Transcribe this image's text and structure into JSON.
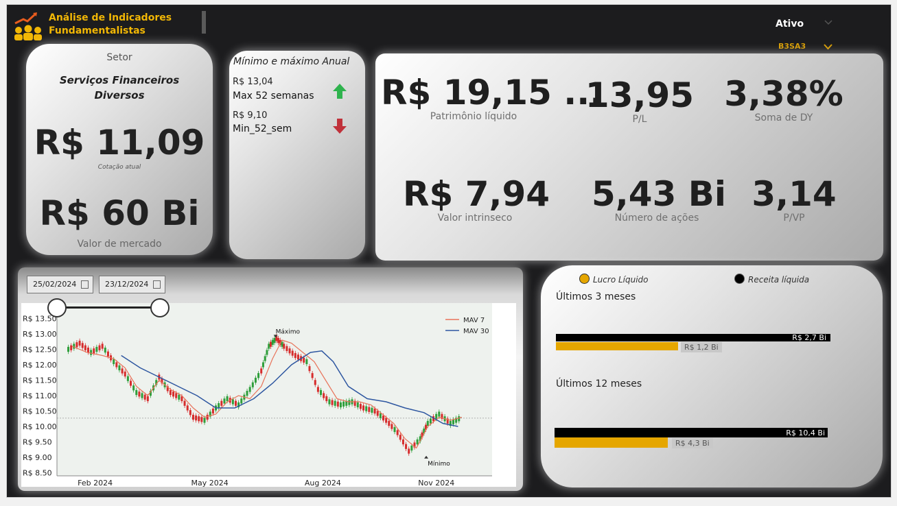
{
  "header": {
    "title_line1": "Análise de Indicadores",
    "title_line2": "Fundamentalistas",
    "logo_icon": "investors-growth-icon",
    "ativo_label": "Ativo",
    "ativo_selected": "B3SA3"
  },
  "setor_card": {
    "setor_label": "Setor",
    "setor_line1": "Serviços Financeiros",
    "setor_line2": "Diversos",
    "cotacao_value": "R$ 11,09",
    "cotacao_label": "Cotação atual",
    "mercado_value": "R$ 60 Bi",
    "mercado_label": "Valor de mercado"
  },
  "minmax_card": {
    "title": "Mínimo e máximo Anual",
    "max_value": "R$ 13,04",
    "max_label": "Max 52 semanas",
    "min_value": "R$ 9,10",
    "min_label": "Min_52_sem",
    "up_color": "#2fb34e",
    "down_color": "#c0313a"
  },
  "indicators": {
    "patrimonio_value": "R$ 19,15 ...",
    "patrimonio_label": "Patrimônio líquido",
    "pl_value": "13,95",
    "pl_label": "P/L",
    "dy_value": "3,38%",
    "dy_label": "Soma de DY",
    "intrinseco_value": "R$ 7,94",
    "intrinseco_label": "Valor intrinseco",
    "acoes_value": "5,43 Bi",
    "acoes_label": "Número de ações",
    "pvp_value": "3,14",
    "pvp_label": "P/VP"
  },
  "date_filter": {
    "start": "25/02/2024",
    "end": "23/12/2024"
  },
  "chart_data": {
    "type": "line",
    "x_ticks": [
      "Feb 2024",
      "May 2024",
      "Aug 2024",
      "Nov 2024"
    ],
    "y_ticks": [
      "R$ 13.50",
      "R$ 13.00",
      "R$ 12.50",
      "R$ 12.00",
      "R$ 11.50",
      "R$ 11.00",
      "R$ 10.50",
      "R$ 10.00",
      "R$ 9.50",
      "R$ 9.00",
      "R$ 8.50"
    ],
    "ylim": [
      8.4,
      13.6
    ],
    "xlim": [
      0,
      11.5
    ],
    "reference_line": 10.27,
    "annotations": [
      {
        "text": "Máximo",
        "x": 5.78,
        "y": 12.88
      },
      {
        "text": "Mínimo",
        "x": 9.76,
        "y": 9.05
      }
    ],
    "legend_position": "top-right",
    "series": [
      {
        "name": "MAV 7",
        "color": "#e8735a",
        "x": [
          0.4,
          0.8,
          1.2,
          1.5,
          1.8,
          2.1,
          2.4,
          2.7,
          3.0,
          3.3,
          3.6,
          3.9,
          4.2,
          4.5,
          4.8,
          5.1,
          5.4,
          5.7,
          5.95,
          6.2,
          6.5,
          6.8,
          7.1,
          7.4,
          7.7,
          8.0,
          8.3,
          8.6,
          8.9,
          9.2,
          9.5,
          9.8,
          10.1,
          10.4,
          10.7
        ],
        "y": [
          12.6,
          12.4,
          12.3,
          12.2,
          11.9,
          11.3,
          11.0,
          11.5,
          11.2,
          11.0,
          10.6,
          10.3,
          10.4,
          10.8,
          11.0,
          10.9,
          11.3,
          12.2,
          12.8,
          12.7,
          12.4,
          12.1,
          11.5,
          10.9,
          10.8,
          10.8,
          10.7,
          10.4,
          10.1,
          9.6,
          9.3,
          10.0,
          10.3,
          10.2,
          10.3
        ]
      },
      {
        "name": "MAV 30",
        "color": "#2d56a0",
        "x": [
          1.7,
          2.2,
          2.7,
          3.2,
          3.7,
          4.2,
          4.7,
          5.2,
          5.7,
          6.2,
          6.7,
          7.0,
          7.3,
          7.7,
          8.2,
          8.7,
          9.2,
          9.7,
          10.2,
          10.6
        ],
        "y": [
          12.3,
          11.9,
          11.6,
          11.3,
          11.0,
          10.6,
          10.6,
          10.9,
          11.4,
          12.0,
          12.4,
          12.45,
          12.1,
          11.3,
          10.9,
          10.8,
          10.6,
          10.45,
          10.1,
          10.0
        ]
      },
      {
        "name": "Price",
        "color": "#333333",
        "x": [
          0.3,
          0.6,
          0.9,
          1.2,
          1.5,
          1.8,
          2.1,
          2.4,
          2.7,
          3.0,
          3.3,
          3.6,
          3.9,
          4.2,
          4.5,
          4.8,
          5.1,
          5.4,
          5.6,
          5.8,
          6.0,
          6.3,
          6.6,
          6.9,
          7.2,
          7.5,
          7.8,
          8.1,
          8.4,
          8.7,
          9.0,
          9.3,
          9.6,
          9.8,
          10.1,
          10.4,
          10.7
        ],
        "y": [
          12.5,
          12.7,
          12.4,
          12.6,
          12.1,
          11.7,
          11.1,
          10.9,
          11.6,
          11.1,
          10.9,
          10.3,
          10.2,
          10.6,
          10.9,
          10.7,
          11.2,
          11.8,
          12.6,
          12.85,
          12.6,
          12.3,
          12.1,
          11.2,
          10.8,
          10.7,
          10.8,
          10.6,
          10.5,
          10.2,
          9.8,
          9.2,
          9.6,
          10.1,
          10.4,
          10.1,
          10.3
        ]
      }
    ]
  },
  "revenue": {
    "legend_lucro": "Lucro Líquido",
    "legend_receita": "Receita líquida",
    "lucro_color": "#e5a600",
    "receita_color": "#000000",
    "period_3m": "Últimos 3 meses",
    "receita_3m": "R$ 2,7 Bi",
    "lucro_3m": "R$ 1,2 Bi",
    "receita_3m_value": 2.7,
    "lucro_3m_value": 1.2,
    "period_12m": "Últimos 12 meses",
    "receita_12m": "R$ 10,4 Bi",
    "lucro_12m": "R$ 4,3 Bi",
    "receita_12m_value": 10.4,
    "lucro_12m_value": 4.3
  }
}
